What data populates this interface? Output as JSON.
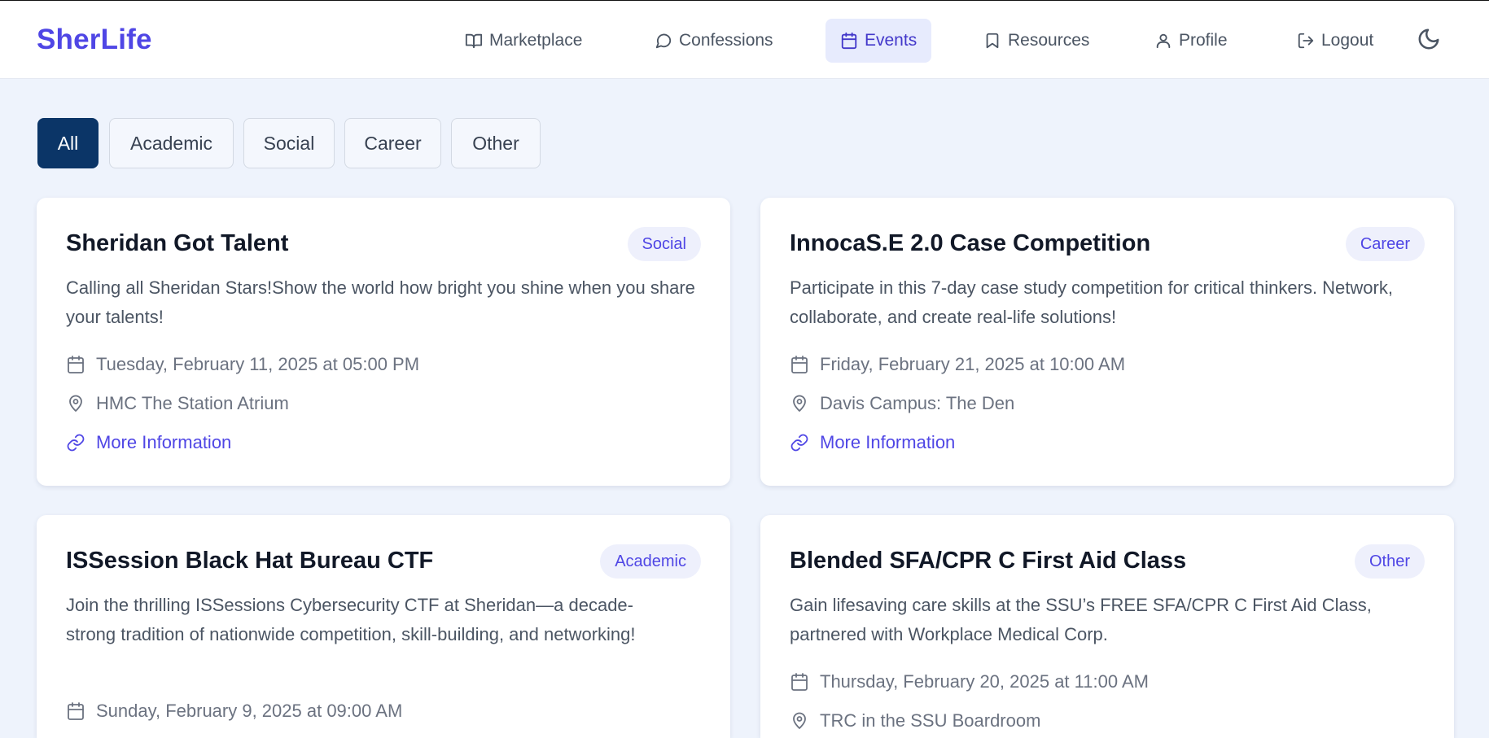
{
  "brand": "SherLife",
  "nav": [
    {
      "label": "Marketplace",
      "icon": "book-open-icon"
    },
    {
      "label": "Confessions",
      "icon": "chat-bubble-icon"
    },
    {
      "label": "Events",
      "icon": "calendar-icon",
      "active": true
    },
    {
      "label": "Resources",
      "icon": "bookmark-icon"
    },
    {
      "label": "Profile",
      "icon": "user-icon"
    },
    {
      "label": "Logout",
      "icon": "logout-icon"
    }
  ],
  "theme_toggle_icon": "moon-icon",
  "filters": [
    {
      "label": "All",
      "active": true
    },
    {
      "label": "Academic"
    },
    {
      "label": "Social"
    },
    {
      "label": "Career"
    },
    {
      "label": "Other"
    }
  ],
  "events": [
    {
      "title": "Sheridan Got Talent",
      "category": "Social",
      "description": "Calling all Sheridan Stars!Show the world how bright you shine when you share your talents!",
      "datetime": "Tuesday, February 11, 2025 at 05:00 PM",
      "location": "HMC The Station Atrium",
      "link_label": "More Information"
    },
    {
      "title": "InnocaS.E 2.0 Case Competition",
      "category": "Career",
      "description": "Participate in this 7-day case study competition for critical thinkers. Network, collaborate, and create real-life solutions!",
      "datetime": "Friday, February 21, 2025 at 10:00 AM",
      "location": "Davis Campus: The Den",
      "link_label": "More Information"
    },
    {
      "title": "ISSession Black Hat Bureau CTF",
      "category": "Academic",
      "description": "Join the thrilling ISSessions Cybersecurity CTF at Sheridan—a decade-strong tradition of nationwide competition, skill-building, and networking!",
      "datetime": "Sunday, February 9, 2025 at 09:00 AM"
    },
    {
      "title": "Blended SFA/CPR C First Aid Class",
      "category": "Other",
      "description": "Gain lifesaving care skills at the SSU’s FREE SFA/CPR C First Aid Class, partnered with Workplace Medical Corp.",
      "datetime": "Thursday, February 20, 2025 at 11:00 AM",
      "location": "TRC in the SSU Boardroom"
    }
  ],
  "colors": {
    "brand": "#4f46e5",
    "active_filter": "#0b3567",
    "page_bg": "#eef3fc",
    "active_nav_bg": "#e7ebfd"
  }
}
